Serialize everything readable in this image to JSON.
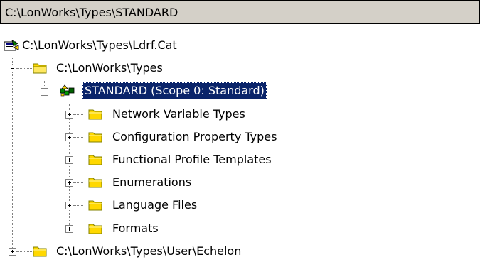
{
  "path_bar": {
    "text": "C:\\LonWorks\\Types\\STANDARD"
  },
  "tree": {
    "catalog": {
      "label": "C:\\LonWorks\\Types\\Ldrf.Cat",
      "icon": "catalog-file-icon"
    },
    "types_folder": {
      "label": "C:\\LonWorks\\Types",
      "icon": "folder-open-icon",
      "expanded": true
    },
    "standard": {
      "label": "STANDARD (Scope 0: Standard)",
      "icon": "resource-set-icon",
      "expanded": true,
      "selected": true
    },
    "children": [
      {
        "label": "Network Variable Types",
        "icon": "folder-icon"
      },
      {
        "label": "Configuration Property Types",
        "icon": "folder-icon"
      },
      {
        "label": "Functional Profile Templates",
        "icon": "folder-icon"
      },
      {
        "label": "Enumerations",
        "icon": "folder-icon"
      },
      {
        "label": "Language Files",
        "icon": "folder-icon"
      },
      {
        "label": "Formats",
        "icon": "folder-icon"
      }
    ],
    "echelon_folder": {
      "label": "C:\\LonWorks\\Types\\User\\Echelon",
      "icon": "folder-icon",
      "expanded": false
    }
  },
  "colors": {
    "selection": "#0a246a",
    "folder": "#ffd800",
    "path_bar_bg": "#d4d0c8"
  }
}
